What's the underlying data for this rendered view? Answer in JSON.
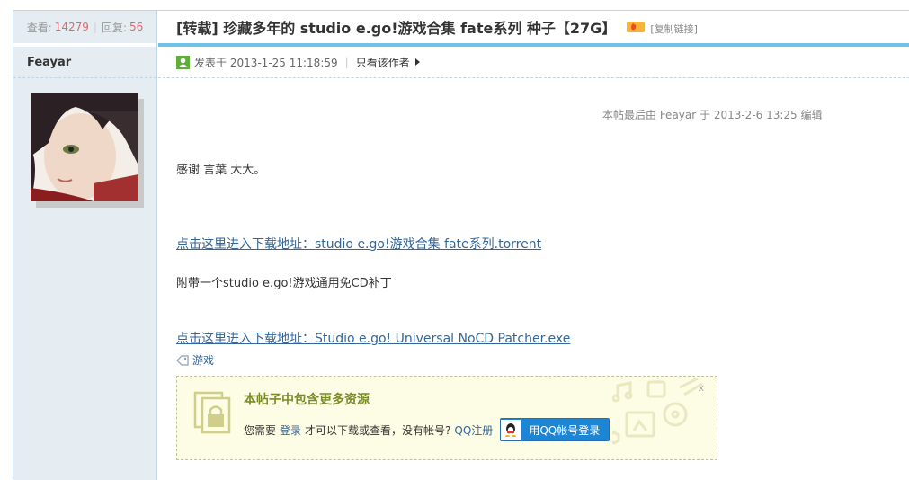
{
  "stats": {
    "views_label": "查看:",
    "views": "14279",
    "sep": "|",
    "replies_label": "回复:",
    "replies": "56"
  },
  "author": {
    "name": "Feayar"
  },
  "thread": {
    "title": "[转载] 珍藏多年的 studio e.go!游戏合集 fate系列 种子【27G】",
    "copy_link": "[复制链接]"
  },
  "post_meta": {
    "posted": "发表于 2013-1-25 11:18:59",
    "sep": "|",
    "only_author": "只看该作者"
  },
  "edit_note": "本帖最后由 Feayar 于 2013-2-6 13:25 编辑",
  "body": {
    "line1": "感谢 言葉 大大。",
    "link1": "点击这里进入下载地址：studio e.go!游戏合集 fate系列.torrent",
    "line2": "附带一个studio e.go!游戏通用免CD补丁",
    "link2": "点击这里进入下载地址：Studio e.go! Universal NoCD Patcher.exe"
  },
  "tag": "游戏",
  "attachment_box": {
    "close": "x",
    "title": "本帖子中包含更多资源",
    "prefix": "您需要",
    "login": "登录",
    "middle": "才可以下载或查看，没有帐号?",
    "register": "QQ注册",
    "qq_button": "用QQ帐号登录"
  },
  "colors": {
    "accent_bar": "#6ec2e8",
    "sidebar_bg": "#e5edf2",
    "link": "#336699",
    "stat_number": "#e66666",
    "attach_title": "#7a8c2a"
  }
}
